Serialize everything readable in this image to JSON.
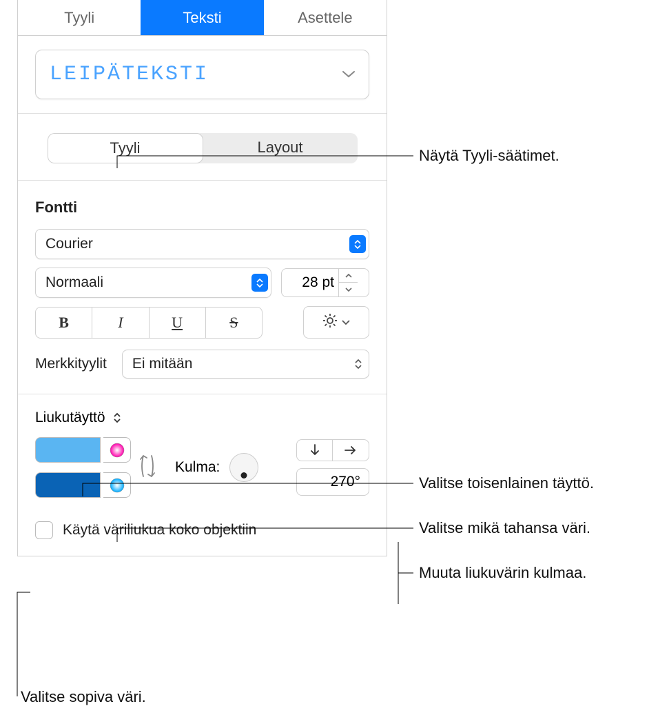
{
  "tabs": {
    "style": "Tyyli",
    "text": "Teksti",
    "arrange": "Asettele"
  },
  "style_name": "LEIPÄTEKSTI",
  "subtabs": {
    "style": "Tyyli",
    "layout": "Layout"
  },
  "font": {
    "section_label": "Fontti",
    "family": "Courier",
    "weight": "Normaali",
    "size": "28 pt",
    "bold": "B",
    "italic": "I",
    "underline": "U",
    "strike": "S"
  },
  "char_styles": {
    "label": "Merkkityylit",
    "value": "Ei mitään"
  },
  "fill": {
    "type": "Liukutäyttö",
    "color1": "#5ab5f2",
    "color2": "#0a63b5",
    "angle_label": "Kulma:",
    "angle_value": "270°"
  },
  "apply_whole": "Käytä väriliukua koko objektiin",
  "callouts": {
    "c1": "Näytä Tyyli-säätimet.",
    "c2": "Valitse toisenlainen täyttö.",
    "c3": "Valitse mikä tahansa väri.",
    "c4": "Muuta liukuvärin kulmaa.",
    "c5": "Valitse sopiva väri."
  }
}
